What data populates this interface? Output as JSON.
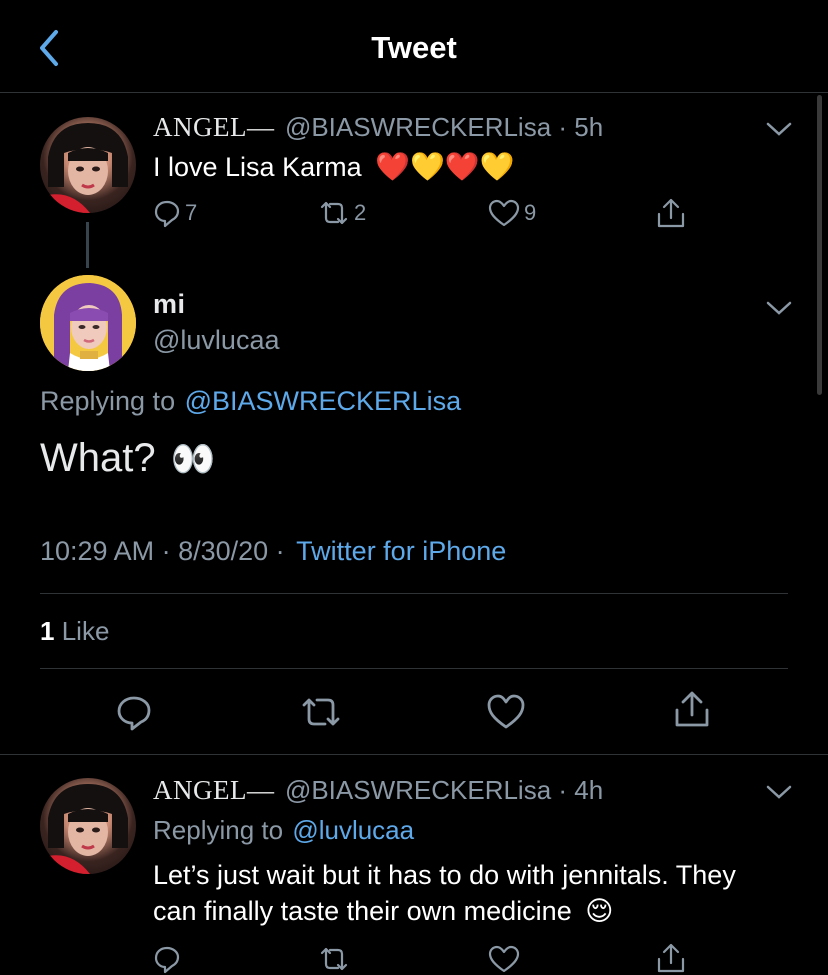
{
  "header": {
    "title": "Tweet"
  },
  "parent_tweet": {
    "display_name": "ANGEL—",
    "handle_time": "@BIASWRECKERLisa · 5h",
    "text": "I love Lisa Karma",
    "emoji": "❤️💛❤️💛",
    "reply_count": "7",
    "retweet_count": "2",
    "like_count": "9"
  },
  "main_tweet": {
    "display_name": "mi",
    "handle": "@luvlucaa",
    "replying_prefix": "Replying to",
    "replying_handle": "@BIASWRECKERLisa",
    "text": "What?",
    "emoji": "👀",
    "time_date": "10:29 AM · 8/30/20 ·",
    "source": "Twitter for iPhone",
    "likes_number": "1",
    "likes_label": "Like"
  },
  "reply_tweet": {
    "display_name": "ANGEL—",
    "handle_time": "@BIASWRECKERLisa · 4h",
    "replying_prefix": "Replying to",
    "replying_handle": "@luvlucaa",
    "text_line1": "Let’s just wait but it has to do with jennitals. They",
    "text_line2": "can finally taste their own medicine",
    "emoji": "😌"
  },
  "colors": {
    "accent": "#5ea9ea",
    "muted": "#8b98a5",
    "divider": "#2f3336",
    "background": "#000000"
  }
}
